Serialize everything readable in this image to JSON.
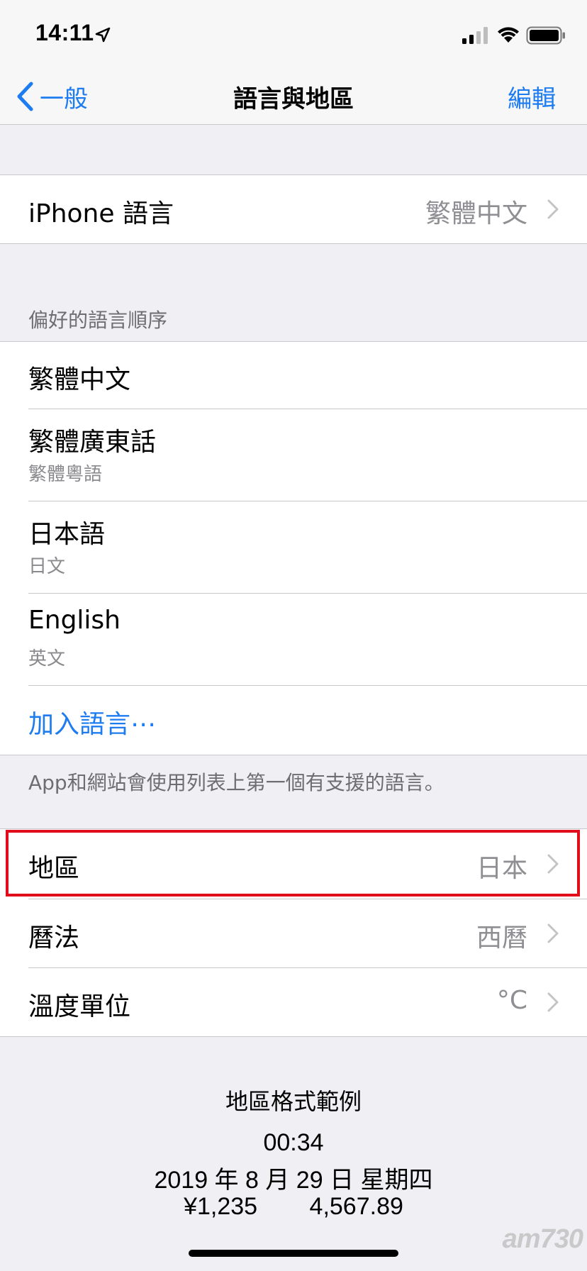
{
  "status_bar": {
    "time": "14:11",
    "location_icon": "location-arrow-icon",
    "signal_icon": "cellular-signal-icon",
    "wifi_icon": "wifi-icon",
    "battery_icon": "battery-icon"
  },
  "nav": {
    "back_label": "一般",
    "title": "語言與地區",
    "edit_label": "編輯"
  },
  "iphone_language": {
    "label": "iPhone 語言",
    "value": "繁體中文"
  },
  "preferred_languages": {
    "header": "偏好的語言順序",
    "items": [
      {
        "label": "繁體中文",
        "sub": ""
      },
      {
        "label": "繁體廣東話",
        "sub": "繁體粵語"
      },
      {
        "label": "日本語",
        "sub": "日文"
      },
      {
        "label": "English",
        "sub": "英文"
      }
    ],
    "add_label": "加入語言⋯",
    "footer": "App和網站會使用列表上第一個有支援的語言。"
  },
  "region_settings": [
    {
      "label": "地區",
      "value": "日本"
    },
    {
      "label": "曆法",
      "value": "西曆"
    },
    {
      "label": "溫度單位",
      "value": "°C"
    }
  ],
  "format_example": {
    "title": "地區格式範例",
    "time": "00:34",
    "date": "2019 年 8 月 29 日 星期四",
    "currency": "¥1,235",
    "number": "4,567.89"
  },
  "watermark": "am730",
  "colors": {
    "accent": "#1e7cf1",
    "highlight": "#e10d1c",
    "background": "#efeff4"
  }
}
